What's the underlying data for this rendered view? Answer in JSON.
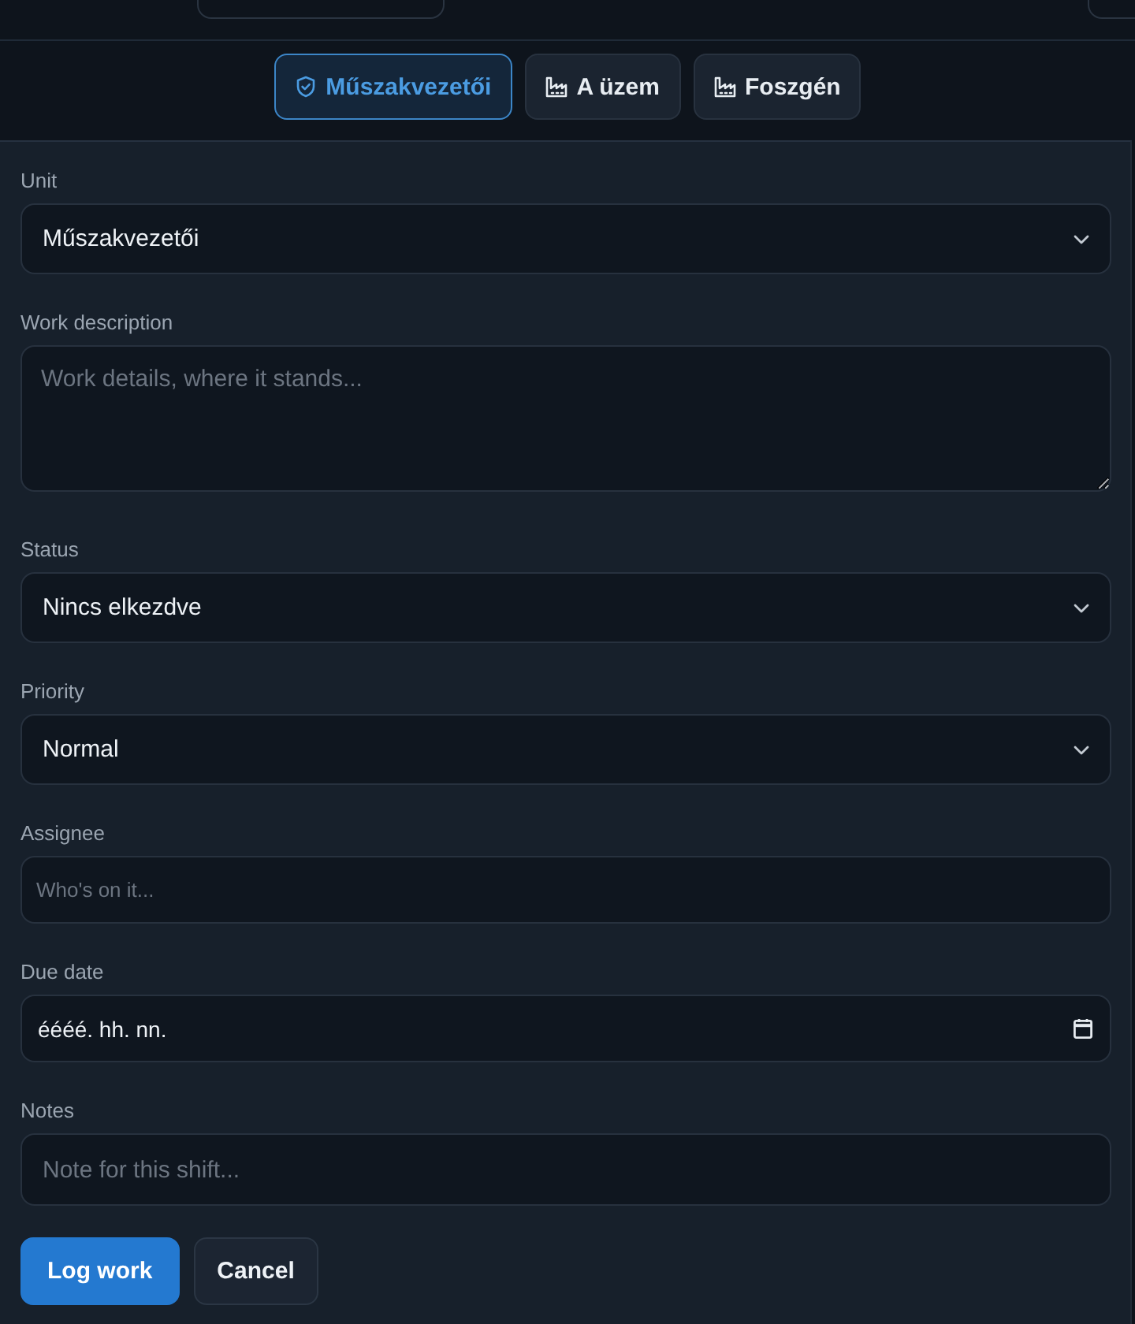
{
  "tabs": [
    {
      "label": "Műszakvezetői",
      "kind": "role",
      "selected": true
    },
    {
      "label": "A üzem",
      "kind": "plant",
      "selected": false
    },
    {
      "label": "Foszgén",
      "kind": "plant",
      "selected": false
    }
  ],
  "form": {
    "fields": [
      {
        "kind": "select",
        "label": "Unit",
        "value": "Műszakvezetői"
      },
      {
        "kind": "textarea",
        "label": "Work description",
        "placeholder": "Work details, where it stands..."
      },
      {
        "kind": "select",
        "label": "Status",
        "value": "Nincs elkezdve"
      },
      {
        "kind": "select",
        "label": "Priority",
        "value": "Normal"
      },
      {
        "kind": "input",
        "label": "Assignee",
        "placeholder": "Who's on it..."
      },
      {
        "kind": "date",
        "label": "Due date",
        "value": "éééé. hh. nn."
      },
      {
        "kind": "note",
        "label": "Notes",
        "placeholder": "Note for this shift..."
      }
    ],
    "buttons": [
      {
        "label": "Log work",
        "kind": "primary"
      },
      {
        "label": "Cancel",
        "kind": "secondary"
      }
    ]
  }
}
